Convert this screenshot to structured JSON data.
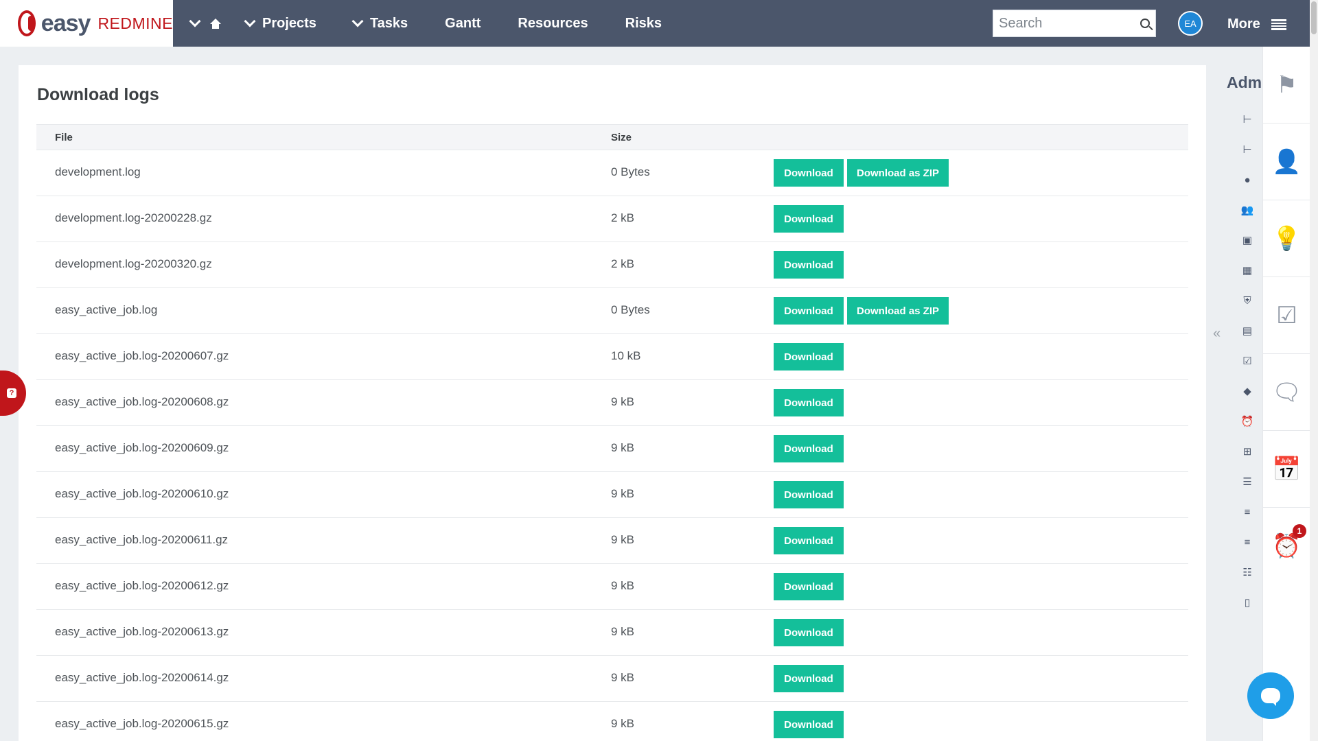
{
  "brand": {
    "easy": "easy",
    "redmine": "REDMINE"
  },
  "nav": {
    "items": [
      {
        "label": "Projects",
        "chevron": true
      },
      {
        "label": "Tasks",
        "chevron": true
      },
      {
        "label": "Gantt",
        "chevron": false
      },
      {
        "label": "Resources",
        "chevron": false
      },
      {
        "label": "Risks",
        "chevron": false
      }
    ],
    "search_placeholder": "Search",
    "avatar_initials": "EA",
    "more_label": "More"
  },
  "page": {
    "title": "Download logs",
    "columns": {
      "file": "File",
      "size": "Size"
    },
    "download_label": "Download",
    "zip_label": "Download as ZIP",
    "rows": [
      {
        "file": "development.log",
        "size": "0 Bytes",
        "zip": true
      },
      {
        "file": "development.log-20200228.gz",
        "size": "2 kB",
        "zip": false
      },
      {
        "file": "development.log-20200320.gz",
        "size": "2 kB",
        "zip": false
      },
      {
        "file": "easy_active_job.log",
        "size": "0 Bytes",
        "zip": true
      },
      {
        "file": "easy_active_job.log-20200607.gz",
        "size": "10 kB",
        "zip": false
      },
      {
        "file": "easy_active_job.log-20200608.gz",
        "size": "9 kB",
        "zip": false
      },
      {
        "file": "easy_active_job.log-20200609.gz",
        "size": "9 kB",
        "zip": false
      },
      {
        "file": "easy_active_job.log-20200610.gz",
        "size": "9 kB",
        "zip": false
      },
      {
        "file": "easy_active_job.log-20200611.gz",
        "size": "9 kB",
        "zip": false
      },
      {
        "file": "easy_active_job.log-20200612.gz",
        "size": "9 kB",
        "zip": false
      },
      {
        "file": "easy_active_job.log-20200613.gz",
        "size": "9 kB",
        "zip": false
      },
      {
        "file": "easy_active_job.log-20200614.gz",
        "size": "9 kB",
        "zip": false
      },
      {
        "file": "easy_active_job.log-20200615.gz",
        "size": "9 kB",
        "zip": false
      }
    ]
  },
  "admin": {
    "title": "Admi",
    "icons": [
      "tree-icon",
      "tree-icon",
      "user-icon",
      "users-icon",
      "id-card-icon",
      "calendar-icon",
      "shield-icon",
      "clipboard-icon",
      "clipboard-check-icon",
      "diamond-icon",
      "alarm-icon",
      "plus-square-icon",
      "list-icon",
      "filter-icon",
      "filter-icon",
      "server-icon",
      "document-icon"
    ]
  },
  "sidebar": {
    "icons": [
      "flag-icon",
      "person-icon",
      "lightbulb-icon",
      "checkbox-icon",
      "comment-icon",
      "calendar-icon",
      "alarm-clock-icon"
    ],
    "alarm_badge": "1"
  },
  "colors": {
    "topbar": "#4b566b",
    "brand_red": "#c0161b",
    "button": "#14bf9a",
    "chat": "#1f9ee8"
  }
}
